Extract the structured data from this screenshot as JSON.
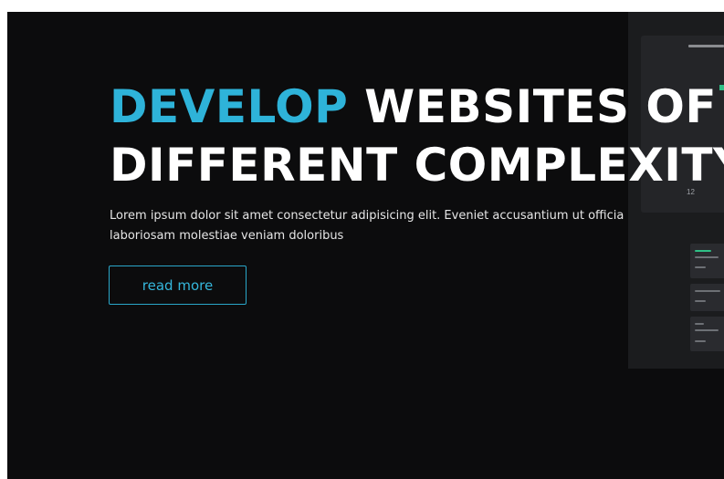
{
  "hero": {
    "headline_accent": "DEVELOP",
    "headline_rest": "WEBSITES OF",
    "headline_line2": "DIFFERENT COMPLEXITY",
    "lead": "Lorem ipsum dolor sit amet consectetur adipisicing elit. Eveniet accusantium ut officia laboriosam molestiae veniam doloribus",
    "button_label": "read more"
  },
  "preview": {
    "number": "12"
  },
  "colors": {
    "background": "#0c0c0d",
    "accent": "#2eb3d9",
    "text": "#ffffff",
    "preview_panel": "#1b1c1e",
    "preview_green": "#2fbf86"
  }
}
